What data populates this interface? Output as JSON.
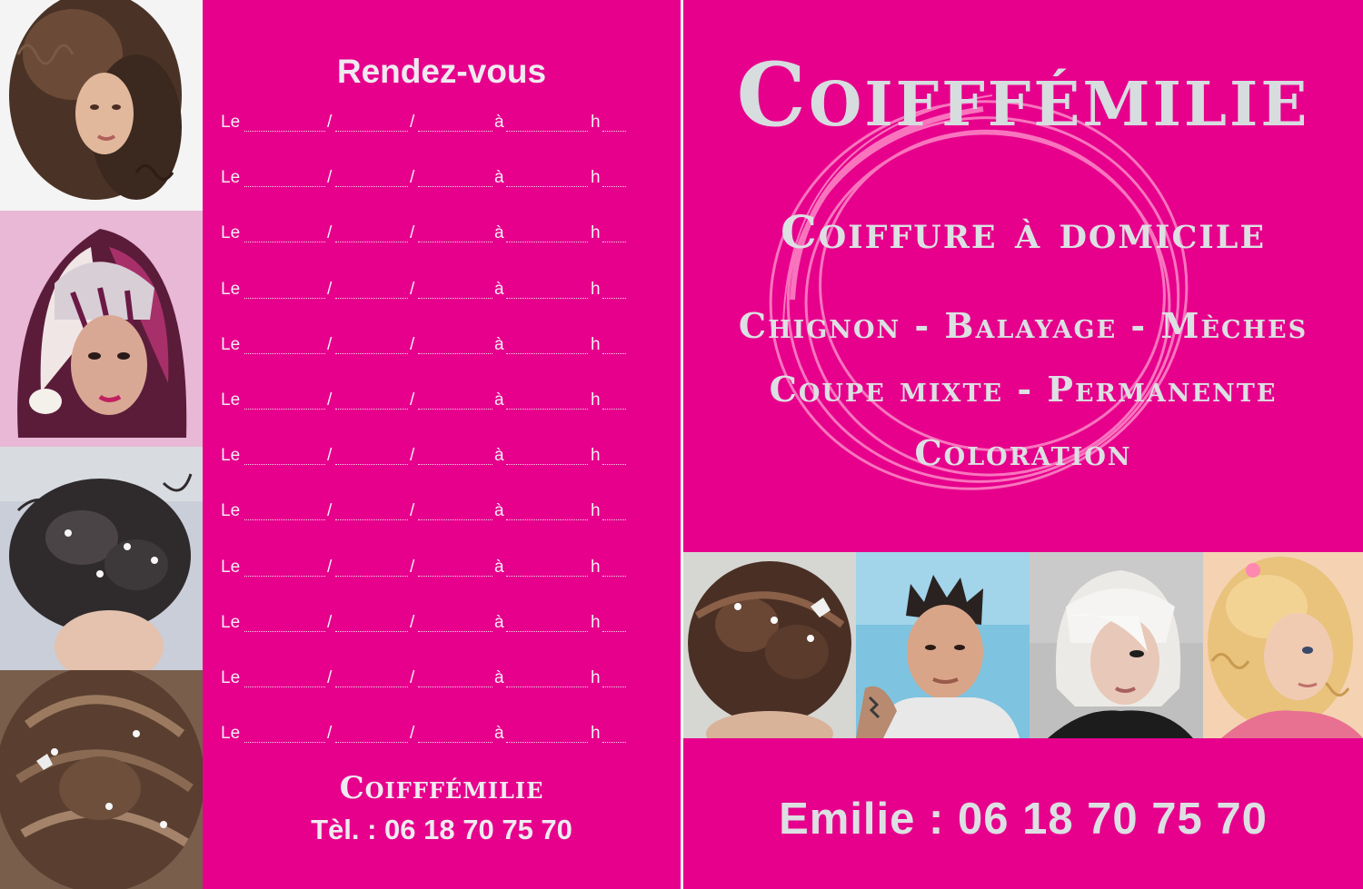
{
  "appointment_card": {
    "title": "Rendez-vous",
    "row_labels": {
      "le": "Le",
      "sep1": "/",
      "sep2": "/",
      "a": "à",
      "h": "h"
    },
    "row_count": 12,
    "brand": "Coifffémilie",
    "phone": "Tèl. : 06 18 70 75 70"
  },
  "flyer": {
    "brand": "Coifffémilie",
    "tagline": "Coiffure à domicile",
    "services": [
      "Chignon - Balayage - Mèches",
      "Coupe mixte - Permanente",
      "Coloration"
    ],
    "contact": "Emilie : 06 18 70 75 70"
  },
  "colors": {
    "background": "#e6008c",
    "text_light": "#dce0e2",
    "swirl": "#ff9ccf"
  },
  "photos": {
    "left_column": [
      "curly-hair-woman-photo",
      "purple-streaked-hair-woman-photo",
      "updo-hairstyle-photo",
      "braided-bun-photo"
    ],
    "bottom_row": [
      "bridal-updo-photo",
      "man-spiky-hair-photo",
      "platinum-bob-woman-photo",
      "curly-child-photo"
    ]
  }
}
